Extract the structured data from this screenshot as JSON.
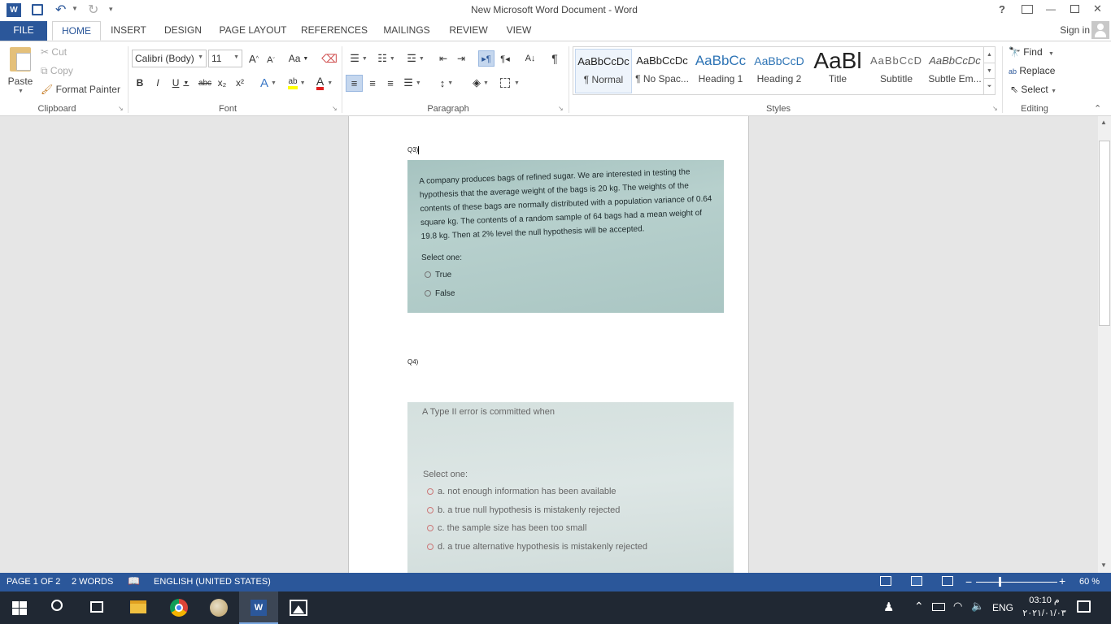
{
  "titlebar": {
    "title": "New Microsoft Word Document - Word",
    "help": "?",
    "minimize": "—",
    "close": "✕"
  },
  "tabs": {
    "file": "FILE",
    "home": "HOME",
    "insert": "INSERT",
    "design": "DESIGN",
    "page_layout": "PAGE LAYOUT",
    "references": "REFERENCES",
    "mailings": "MAILINGS",
    "review": "REVIEW",
    "view": "VIEW",
    "sign_in": "Sign in"
  },
  "clipboard": {
    "paste": "Paste",
    "cut": "Cut",
    "copy": "Copy",
    "format_painter": "Format Painter",
    "label": "Clipboard"
  },
  "font": {
    "name": "Calibri (Body)",
    "size": "11",
    "grow": "A",
    "shrink": "A",
    "change_case": "Aa",
    "bold": "B",
    "italic": "I",
    "underline": "U",
    "strike": "abc",
    "subscript": "x₂",
    "superscript": "x²",
    "label": "Font"
  },
  "paragraph": {
    "label": "Paragraph"
  },
  "styles": {
    "label": "Styles",
    "items": [
      {
        "sample": "AaBbCcDc",
        "name": "¶ Normal"
      },
      {
        "sample": "AaBbCcDc",
        "name": "¶ No Spac..."
      },
      {
        "sample": "AaBbCc",
        "name": "Heading 1"
      },
      {
        "sample": "AaBbCcD",
        "name": "Heading 2"
      },
      {
        "sample": "AaBl",
        "name": "Title"
      },
      {
        "sample": "AaBbCcD",
        "name": "Subtitle"
      },
      {
        "sample": "AaBbCcDc",
        "name": "Subtle Em..."
      }
    ]
  },
  "editing": {
    "find": "Find",
    "replace": "Replace",
    "select": "Select",
    "label": "Editing"
  },
  "document": {
    "q3_label": "Q3)",
    "q3_text": "A company produces bags of refined sugar. We are interested in testing the hypothesis that the average weight of the bags is 20 kg. The weights of the contents of these bags are normally distributed with a population variance of 0.64 square kg. The contents of a random sample of 64 bags had a mean weight of 19.8 kg. Then at 2% level the null hypothesis will be accepted.",
    "q3_select": "Select one:",
    "q3_opt1": "True",
    "q3_opt2": "False",
    "q4_label": "Q4)",
    "q4_text": "A Type II error is committed when",
    "q4_select": "Select one:",
    "q4_opts": [
      "a. not enough information has been available",
      "b. a true null hypothesis is mistakenly rejected",
      "c. the sample size has been too small",
      "d. a true alternative hypothesis is mistakenly rejected"
    ]
  },
  "status": {
    "page": "PAGE 1 OF 2",
    "words": "2 WORDS",
    "language": "ENGLISH (UNITED STATES)",
    "zoom": "60 %",
    "zoom_percent": 60
  },
  "taskbar": {
    "lang": "ENG",
    "time": "03:10 م",
    "date": "٢٠٢١/٠١/٠٣"
  },
  "colors": {
    "word_blue": "#2b579a",
    "taskbar": "#202833"
  }
}
